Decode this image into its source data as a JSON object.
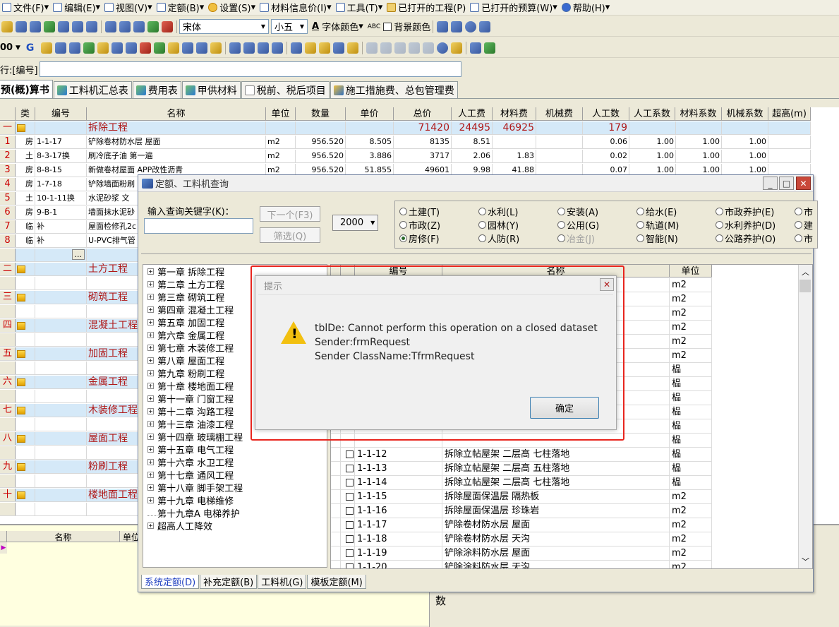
{
  "menubar": {
    "items": [
      "文件(F)",
      "编辑(E)",
      "视图(V)",
      "定额(B)",
      "设置(S)",
      "材料信息价(I)",
      "工具(T)",
      "已打开的工程(P)",
      "已打开的预算(W)",
      "帮助(H)"
    ]
  },
  "toolbar": {
    "font_name": "宋体",
    "font_size": "小五",
    "font_color_label": "字体颜色",
    "bg_color_label": "背景颜色",
    "zoom": "00"
  },
  "formula": {
    "label": "行:[编号]"
  },
  "tabs": [
    "预(概)算书",
    "工料机汇总表",
    "费用表",
    "甲供材料",
    "税前、税后项目",
    "施工措施费、总包管理费"
  ],
  "grid": {
    "headers": [
      "类",
      "编号",
      "名称",
      "单位",
      "数量",
      "单价",
      "总价",
      "人工费",
      "材料费",
      "机械费",
      "人工数",
      "人工系数",
      "材料系数",
      "机械系数",
      "超高(m)"
    ],
    "section1": {
      "idx": "一",
      "name": "拆除工程",
      "total": "71420",
      "labor": "24495",
      "material": "46925",
      "labor_num": "179"
    },
    "rows": [
      {
        "idx": "1",
        "cat": "房",
        "code": "1-1-17",
        "name": "铲除卷材防水层 屋面",
        "unit": "m2",
        "qty": "956.520",
        "price": "8.505",
        "total": "8135",
        "labor": "8.51",
        "material": "",
        "labor_num": "0.06",
        "lc": "1.00",
        "mc": "1.00",
        "jc": "1.00"
      },
      {
        "idx": "2",
        "cat": "土",
        "code": "8-3-17换",
        "name": "刷冷底子油 第一遍",
        "unit": "m2",
        "qty": "956.520",
        "price": "3.886",
        "total": "3717",
        "labor": "2.06",
        "material": "1.83",
        "labor_num": "0.02",
        "lc": "1.00",
        "mc": "1.00",
        "jc": "1.00"
      },
      {
        "idx": "3",
        "cat": "房",
        "code": "8-8-15",
        "name": "新做卷材屋面 APP改性沥青",
        "unit": "m2",
        "qty": "956.520",
        "price": "51.855",
        "total": "49601",
        "labor": "9.98",
        "material": "41.88",
        "labor_num": "0.07",
        "lc": "1.00",
        "mc": "1.00",
        "jc": "1.00"
      },
      {
        "idx": "4",
        "cat": "房",
        "code": "1-7-18",
        "name": "铲除墙面粉刷",
        "unit": "",
        "qty": "",
        "price": "",
        "total": "",
        "labor": "",
        "material": "",
        "labor_num": "",
        "lc": "",
        "mc": "",
        "jc": ""
      },
      {
        "idx": "5",
        "cat": "土",
        "code": "10-1-11换",
        "name": "水泥砂浆 文",
        "unit": "",
        "qty": "",
        "price": "",
        "total": "",
        "labor": "",
        "material": "",
        "labor_num": "",
        "lc": "",
        "mc": "",
        "jc": ""
      },
      {
        "idx": "6",
        "cat": "房",
        "code": "9-B-1",
        "name": "墙面抹水泥砂",
        "unit": "",
        "qty": "",
        "price": "",
        "total": "",
        "labor": "",
        "material": "",
        "labor_num": "",
        "lc": "",
        "mc": "",
        "jc": ""
      },
      {
        "idx": "7",
        "cat": "临",
        "code": "补",
        "name": "屋面检修孔2c",
        "unit": "",
        "qty": "",
        "price": "",
        "total": "",
        "labor": "",
        "material": "",
        "labor_num": "",
        "lc": "",
        "mc": "",
        "jc": ""
      },
      {
        "idx": "8",
        "cat": "临",
        "code": "补",
        "name": "U-PVC排气管",
        "unit": "",
        "qty": "",
        "price": "",
        "total": "",
        "labor": "",
        "material": "",
        "labor_num": "",
        "lc": "",
        "mc": "",
        "jc": ""
      }
    ],
    "ellipsis": "...",
    "sections": [
      {
        "idx": "二",
        "name": "土方工程"
      },
      {
        "idx": "三",
        "name": "砌筑工程"
      },
      {
        "idx": "四",
        "name": "混凝土工程"
      },
      {
        "idx": "五",
        "name": "加固工程"
      },
      {
        "idx": "六",
        "name": "金属工程"
      },
      {
        "idx": "七",
        "name": "木装修工程"
      },
      {
        "idx": "八",
        "name": "屋面工程"
      },
      {
        "idx": "九",
        "name": "粉刷工程"
      },
      {
        "idx": "十",
        "name": "楼地面工程"
      }
    ]
  },
  "bottom": {
    "col_name": "名称",
    "col_unit": "单位",
    "right_label": "数"
  },
  "query": {
    "title": "定额、工料机查询",
    "keyword_label": "输入查询关键字(K)：",
    "next_button": "下一个(F3)",
    "filter_button": "筛选(Q)",
    "year": "2000",
    "radios": [
      {
        "label": "土建(T)",
        "on": false
      },
      {
        "label": "水利(L)",
        "on": false
      },
      {
        "label": "安装(A)",
        "on": false
      },
      {
        "label": "给水(E)",
        "on": false
      },
      {
        "label": "市政养护(E)",
        "on": false
      },
      {
        "label": "市",
        "on": false
      },
      {
        "label": "市政(Z)",
        "on": false
      },
      {
        "label": "园林(Y)",
        "on": false
      },
      {
        "label": "公用(G)",
        "on": false
      },
      {
        "label": "轨道(M)",
        "on": false
      },
      {
        "label": "水利养护(D)",
        "on": false
      },
      {
        "label": "建",
        "on": false
      },
      {
        "label": "房修(F)",
        "on": true
      },
      {
        "label": "人防(R)",
        "on": false
      },
      {
        "label": "冶金(J)",
        "on": false,
        "dis": true
      },
      {
        "label": "智能(N)",
        "on": false
      },
      {
        "label": "公路养护(O)",
        "on": false
      },
      {
        "label": "市",
        "on": false
      }
    ],
    "tree": [
      "第一章 拆除工程",
      "第二章 土方工程",
      "第三章 砌筑工程",
      "第四章 混凝土工程",
      "第五章 加固工程",
      "第六章 金属工程",
      "第七章 木装修工程",
      "第八章 屋面工程",
      "第九章 粉刷工程",
      "第十章 楼地面工程",
      "第十一章 门窗工程",
      "第十二章 沟路工程",
      "第十三章 油漆工程",
      "第十四章 玻璃棚工程",
      "第十五章 电气工程",
      "第十六章 水卫工程",
      "第十七章 通风工程",
      "第十八章 脚手架工程",
      "第十九章 电梯维修",
      "第十九章A 电梯养护",
      "超高人工降效"
    ],
    "table": {
      "headers": [
        "编号",
        "名称",
        "单位"
      ],
      "top_units": [
        "m2",
        "m2",
        "m2",
        "m2",
        "m2",
        "m2",
        "榀",
        "榀",
        "榀",
        "榀",
        "榀",
        "榀"
      ],
      "row12": {
        "code": "1-1-12",
        "name": "拆除立帖屋架 二层高 七柱落地",
        "unit": "榀"
      },
      "rows": [
        {
          "code": "1-1-13",
          "name": "拆除立帖屋架 二层高 五柱落地",
          "unit": "榀"
        },
        {
          "code": "1-1-14",
          "name": "拆除立帖屋架 二层高 七柱落地",
          "unit": "榀"
        },
        {
          "code": "1-1-15",
          "name": "拆除屋面保温层 隔热板",
          "unit": "m2"
        },
        {
          "code": "1-1-16",
          "name": "拆除屋面保温层 珍珠岩",
          "unit": "m2"
        },
        {
          "code": "1-1-17",
          "name": "铲除卷材防水层 屋面",
          "unit": "m2"
        },
        {
          "code": "1-1-18",
          "name": "铲除卷材防水层 天沟",
          "unit": "m2"
        },
        {
          "code": "1-1-19",
          "name": "铲除涂料防水层 屋面",
          "unit": "m2"
        },
        {
          "code": "1-1-20",
          "name": "铲除涂料防水层 天沟",
          "unit": "m2"
        }
      ]
    },
    "bottom_tabs": [
      "系统定额(D)",
      "补充定额(B)",
      "工料机(G)",
      "模板定额(M)"
    ]
  },
  "dialog": {
    "title": "提示",
    "line1": "tblDe: Cannot perform this operation on a closed dataset",
    "line2": "Sender:frmRequest",
    "line3": "Sender ClassName:TfrmRequest",
    "ok": "确定"
  },
  "colors": {
    "highlight": "#e8251e",
    "section_bg": "#d5e9f8",
    "section_text": "#b01818"
  }
}
